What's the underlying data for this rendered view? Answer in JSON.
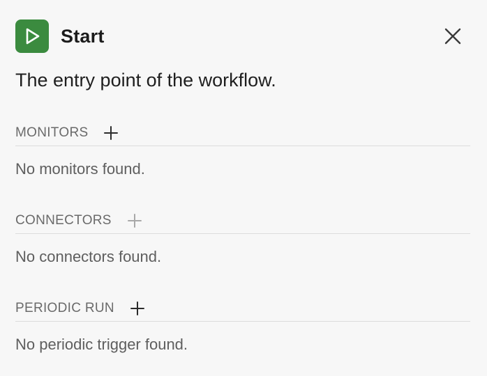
{
  "header": {
    "title": "Start",
    "icon": "play-icon",
    "icon_color": "#3b8b3f",
    "close_icon": "close-icon"
  },
  "description": "The entry point of the workflow.",
  "sections": [
    {
      "label": "MONITORS",
      "empty_text": "No monitors found.",
      "add_enabled": true
    },
    {
      "label": "CONNECTORS",
      "empty_text": "No connectors found.",
      "add_enabled": false
    },
    {
      "label": "PERIODIC RUN",
      "empty_text": "No periodic trigger found.",
      "add_enabled": true
    }
  ]
}
